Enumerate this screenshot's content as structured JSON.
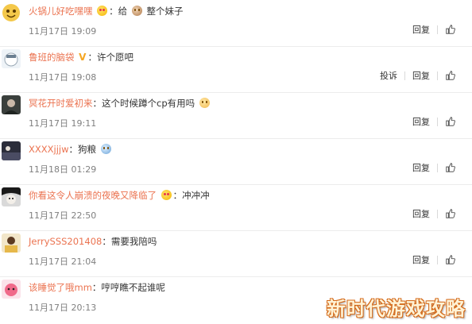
{
  "comments": [
    {
      "user": "火锅儿好吃嘿嘿",
      "badge": "",
      "emoji_after_user": "heart-eyes-emoji",
      "text": "给",
      "emoji_in_text": "monkey-emoji",
      "text2": "整个妹子",
      "time": "11月17日 19:09",
      "report": ""
    },
    {
      "user": "鲁班的脑袋",
      "badge": "V",
      "emoji_after_user": "",
      "text": "许个愿吧",
      "emoji_in_text": "",
      "text2": "",
      "time": "11月17日 19:08",
      "report": "投诉"
    },
    {
      "user": "冥花开时爱初来",
      "badge": "",
      "emoji_after_user": "",
      "text": "这个时候蹲个cp有用吗",
      "emoji_in_text": "cat-emoji",
      "text2": "",
      "time": "11月17日 19:11",
      "report": ""
    },
    {
      "user": "XXXXjjjw",
      "badge": "",
      "emoji_after_user": "",
      "text": "狗粮",
      "emoji_in_text": "dog-emoji",
      "text2": "",
      "time": "11月18日 01:29",
      "report": ""
    },
    {
      "user": "你看这令人崩溃的夜晚又降临了",
      "badge": "",
      "emoji_after_user": "heart-eyes-emoji",
      "text": "冲冲冲",
      "emoji_in_text": "",
      "text2": "",
      "time": "11月17日 22:50",
      "report": ""
    },
    {
      "user": "JerrySSS201408",
      "badge": "",
      "emoji_after_user": "",
      "text": "需要我陪吗",
      "emoji_in_text": "",
      "text2": "",
      "time": "11月17日 21:04",
      "report": ""
    },
    {
      "user": "该睡觉了哦mm",
      "badge": "",
      "emoji_after_user": "",
      "text": "哼哼瞧不起谁呢",
      "emoji_in_text": "",
      "text2": "",
      "time": "11月17日 20:13",
      "report": ""
    }
  ],
  "actions": {
    "reply_label": "回复",
    "like_icon": "thumbs-up-icon"
  },
  "watermark": "新时代游戏攻略",
  "colors": {
    "username": "#eb7350",
    "time": "#808080",
    "text": "#333333"
  }
}
